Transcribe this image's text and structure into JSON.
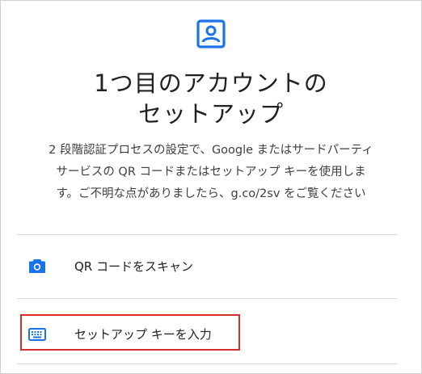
{
  "header": {
    "icon": "account-box-icon",
    "title_line1": "1つ目のアカウントの",
    "title_line2": "セットアップ"
  },
  "description": {
    "line1": "2 段階認証プロセスの設定で、Google またはサードパーティ",
    "line2": "サービスの QR コードまたはセットアップ キーを使用しま",
    "line3": "す。ご不明な点がありましたら、g.co/2sv をご覧ください"
  },
  "options": [
    {
      "icon": "camera-icon",
      "label": "QR コードをスキャン"
    },
    {
      "icon": "keyboard-icon",
      "label": "セットアップ キーを入力",
      "highlighted": true
    }
  ],
  "colors": {
    "accent": "#1a73e8",
    "highlight": "#d32f2f",
    "divider": "#dadce0"
  }
}
